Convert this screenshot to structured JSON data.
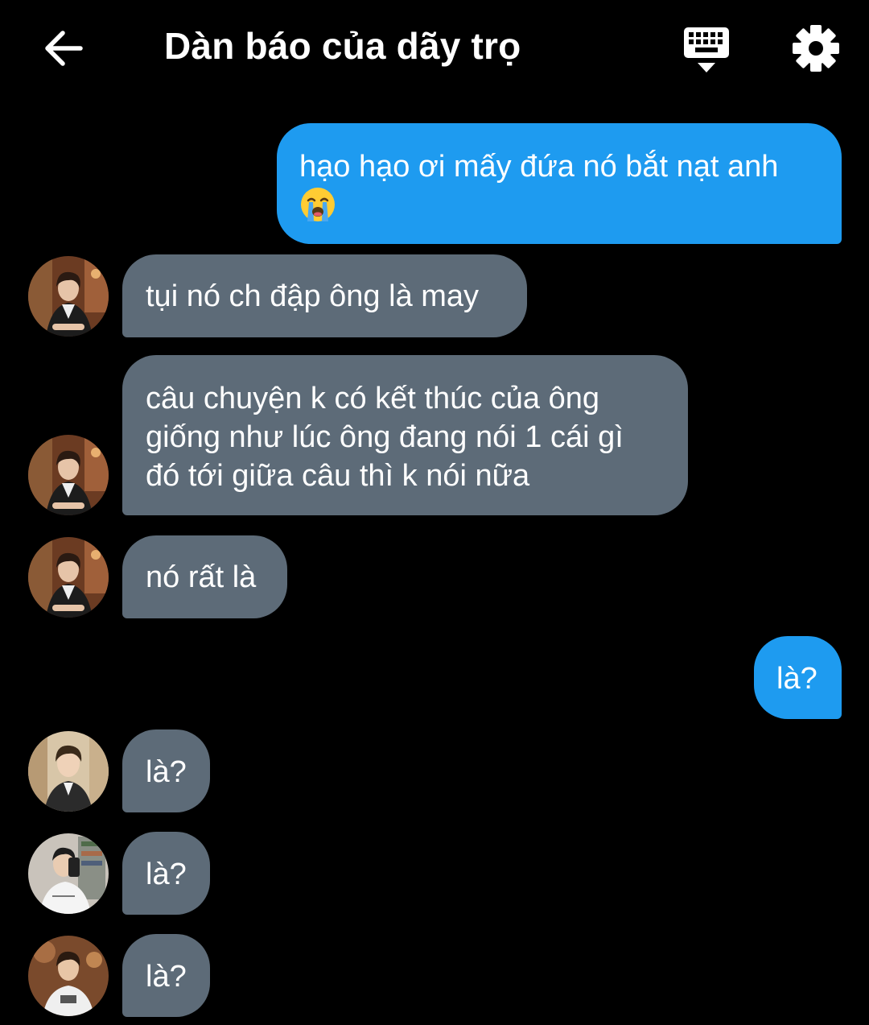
{
  "header": {
    "title": "Dàn báo của dãy trọ",
    "back_icon": "arrow-left-icon",
    "keyboard_icon": "keyboard-icon",
    "settings_icon": "gear-icon"
  },
  "colors": {
    "background": "#000000",
    "outgoing_bubble": "#1e9bf0",
    "incoming_bubble": "#5d6b78",
    "text": "#ffffff"
  },
  "messages": [
    {
      "direction": "out",
      "text": "hạo hạo ơi mấy đứa nó bắt nạt anh",
      "emoji": "loudly-crying-face-icon"
    },
    {
      "direction": "in",
      "text": "tụi nó ch đập ông là may"
    },
    {
      "direction": "in",
      "text": "câu chuyện k có kết thúc của ông\ngiống như lúc ông đang nói 1 cái gì\nđó tới giữa câu thì k nói nữa"
    },
    {
      "direction": "in",
      "text": "nó rất là"
    },
    {
      "direction": "out",
      "text": "là?"
    },
    {
      "direction": "in",
      "text": "là?"
    },
    {
      "direction": "in",
      "text": "là?"
    },
    {
      "direction": "in",
      "text": "là?"
    }
  ]
}
